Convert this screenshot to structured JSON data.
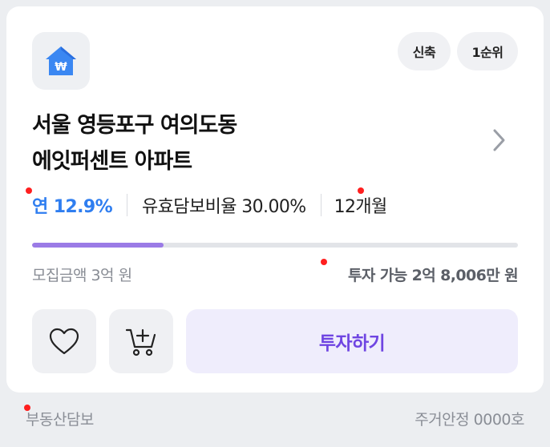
{
  "product": {
    "icon": "house-won-icon",
    "badges": {
      "new": "신축",
      "rank": "1순위"
    },
    "title_line1": "서울 영등포구 여의도동",
    "title_line2": "에잇퍼센트 아파트",
    "rate": "연 12.9%",
    "ltv": "유효담보비율 30.00%",
    "period": "12개월",
    "progress_fraction": 0.27,
    "raise_amount": "모집금액 3억 원",
    "available": "투자 가능 2억 8,006만 원"
  },
  "actions": {
    "like_icon": "heart-icon",
    "cart_icon": "cart-add-icon",
    "invest_label": "투자하기"
  },
  "footer": {
    "collateral": "부동산담보",
    "certification": "주거안정 0000호"
  },
  "colors": {
    "accent_blue": "#2f7ef0",
    "accent_purple": "#6f45e2",
    "progress_fill": "#9b7be6",
    "marker_red": "#ff1f1f"
  }
}
